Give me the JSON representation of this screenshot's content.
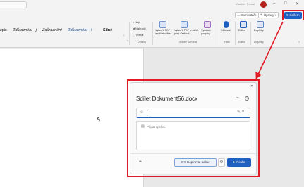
{
  "titlebar": {
    "user_name": "Vladimír Prchal",
    "minimize": "–",
    "restore": "□",
    "close": "✕"
  },
  "actions": {
    "comments": "Komentáře",
    "editing": "Úpravy",
    "share": "Sdílet"
  },
  "ribbon": {
    "styles": [
      "zpis",
      "Zdůraznění - j",
      "Zdůraznění",
      "Zdůraznění - i",
      "Silné"
    ],
    "find": "Najít",
    "replace": "Nahradit",
    "select": "Vybrat",
    "editing_group": "Úpravy",
    "pdf_share_1": "Vytvořit PDF",
    "pdf_share_2": "a sdílet odkaz",
    "pdf_outlook_1": "Vytvořit PDF a sdílet",
    "pdf_outlook_2": "přes Outlook",
    "sign_1": "Vyžádat",
    "sign_2": "podpisy",
    "acrobat_group": "Adobe Acrobat",
    "dictate": "Diktovat",
    "voice_group": "Hlas",
    "editor": "Editor",
    "editor_group": "Editor",
    "addins": "Doplňky",
    "addins_group": "Doplňky"
  },
  "dialog": {
    "close": "✕",
    "title": "Sdílet Dokument56.docx",
    "dash": "–",
    "help": "?",
    "message_placeholder": "Přidat zprávu",
    "copy_link": "Kopírovat odkaz",
    "send": "Poslat"
  },
  "colors": {
    "accent": "#1f5fbf",
    "highlight": "#e01b24"
  }
}
